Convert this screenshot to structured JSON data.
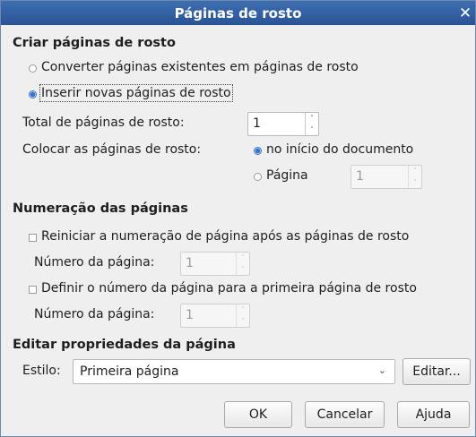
{
  "window": {
    "title": "Páginas de rosto",
    "close_glyph": "✕"
  },
  "create": {
    "heading": "Criar páginas de rosto",
    "convert_label": "Converter páginas existentes em páginas de rosto",
    "insert_label": "Inserir novas páginas de rosto",
    "total_label": "Total de páginas de rosto:",
    "total_value": "1",
    "place_label": "Colocar as páginas de rosto:",
    "at_start_label": "no início do documento",
    "page_label": "Página",
    "page_value": "1"
  },
  "numbering": {
    "heading": "Numeração das páginas",
    "restart_label": "Reiniciar a numeração de página após as páginas de rosto",
    "restart_page_label": "Número da página:",
    "restart_page_value": "1",
    "set_first_label": "Definir o número da página para a primeira página de rosto",
    "first_page_label": "Número da página:",
    "first_page_value": "1"
  },
  "props": {
    "heading": "Editar propriedades da página",
    "style_label": "Estilo:",
    "style_value": "Primeira página",
    "edit_button": "Editar..."
  },
  "buttons": {
    "ok": "OK",
    "cancel": "Cancelar",
    "help": "Ajuda"
  },
  "icons": {
    "spin_up": "˄",
    "spin_down": "˅",
    "combo_arrow": "⌄"
  }
}
